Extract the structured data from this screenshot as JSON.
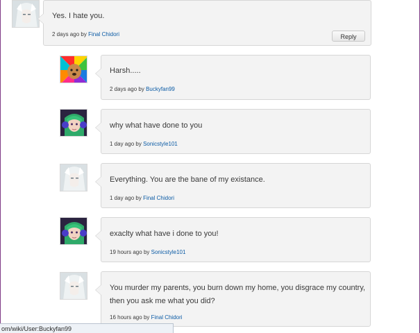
{
  "comments": [
    {
      "text": "Yes. I hate you.",
      "time": "2 days ago",
      "by": "by",
      "user": "Final Chidori",
      "avatar": "white-haired-avatar",
      "has_reply": true
    },
    {
      "text": "Harsh.....",
      "time": "2 days ago",
      "by": "by",
      "user": "Buckyfan99",
      "avatar": "dog-avatar"
    },
    {
      "text": "why what have  done to you",
      "time": "1 day ago",
      "by": "by",
      "user": "Sonicstyle101",
      "avatar": "green-haired-avatar"
    },
    {
      "text": "Everything. You are the bane of my existance.",
      "time": "1 day ago",
      "by": "by",
      "user": "Final Chidori",
      "avatar": "white-haired-avatar"
    },
    {
      "text": "exaclty what have i done to you!",
      "time": "19 hours ago",
      "by": "by",
      "user": "Sonicstyle101",
      "avatar": "green-haired-avatar"
    },
    {
      "text": "You murder my parents, you burn down my home, you disgrace my country, then you ask me what you did?",
      "time": "16 hours ago",
      "by": "by",
      "user": "Final Chidori",
      "avatar": "white-haired-avatar"
    }
  ],
  "reply_label": "Reply",
  "status_url": "om/wiki/User:Buckyfan99",
  "colors": {
    "link": "#0b5ba5",
    "bubble": "#f3f3f3",
    "border": "#d6d6d6",
    "frame": "#7f3a86"
  }
}
